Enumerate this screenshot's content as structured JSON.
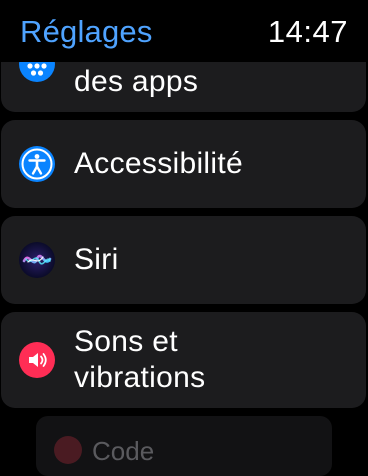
{
  "header": {
    "back_label": "Réglages",
    "time": "14:47"
  },
  "cells": [
    {
      "label": "des apps",
      "icon": "app-grid-icon",
      "color": "#0a84ff"
    },
    {
      "label": "Accessibilité",
      "icon": "accessibility-icon",
      "color": "#0a84ff"
    },
    {
      "label": "Siri",
      "icon": "siri-icon",
      "color": "#3a3aff"
    },
    {
      "label_line1": "Sons et",
      "label_line2": "vibrations",
      "icon": "speaker-icon",
      "color": "#ff2d55"
    },
    {
      "label": "Code",
      "icon": "lock-icon",
      "color": "#ff375f"
    }
  ]
}
